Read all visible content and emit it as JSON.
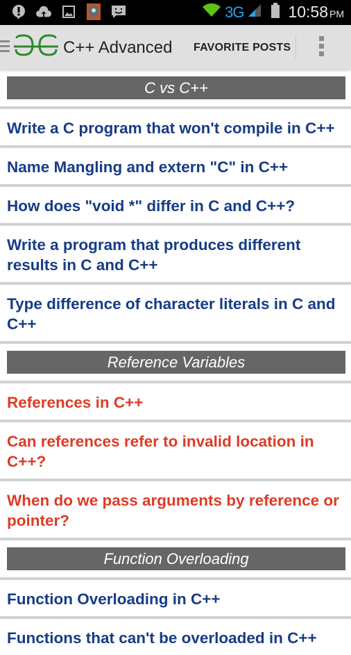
{
  "status_bar": {
    "left_icons": [
      "alert-icon",
      "cloud-upload-icon",
      "image-icon",
      "app-shield-icon",
      "chat-icon"
    ],
    "network": "3G",
    "time": "10:58",
    "ampm": "PM",
    "colors": {
      "wifi": "#5fc314",
      "network": "#2b9ee8"
    }
  },
  "action_bar": {
    "logo": "GG",
    "title": "C++ Advanced",
    "favorite_label": "FAVORITE POSTS",
    "colors": {
      "logo": "#2a8a2a"
    }
  },
  "sections": [
    {
      "title": "C vs C++",
      "items": [
        "Write a C program that won't compile in C++",
        "Name Mangling and extern \"C\" in C++",
        "How does \"void *\" differ in C and C++?",
        "Write a program that produces different results in C and C++",
        "Type difference of character literals in C and C++"
      ]
    },
    {
      "title": "Reference Variables",
      "items": [
        "References in C++",
        "Can references refer to invalid location in C++?",
        "When do we pass arguments by reference or pointer?"
      ]
    },
    {
      "title": "Function Overloading",
      "items": [
        "Function Overloading in C++",
        "Functions that can't be overloaded in C++"
      ]
    }
  ]
}
